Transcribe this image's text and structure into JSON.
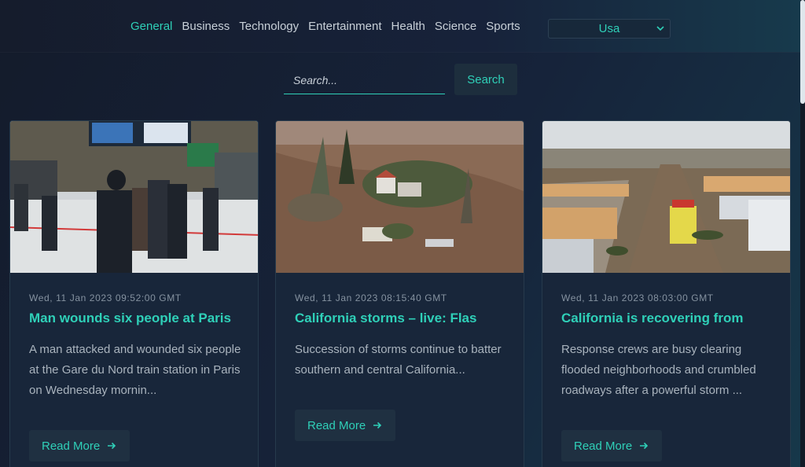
{
  "nav": {
    "items": [
      "General",
      "Business",
      "Technology",
      "Entertainment",
      "Health",
      "Science",
      "Sports"
    ],
    "active": "General"
  },
  "country": {
    "selected": "Usa"
  },
  "search": {
    "placeholder": "Search...",
    "button": "Search"
  },
  "articles": [
    {
      "date": "Wed, 11 Jan 2023 09:52:00 GMT",
      "title": "Man wounds six people at Paris",
      "description": "A man attacked and wounded six people at the Gare du Nord train station in Paris on Wednesday mornin...",
      "cta": "Read More"
    },
    {
      "date": "Wed, 11 Jan 2023 08:15:40 GMT",
      "title": "California storms – live: Flas",
      "description": "Succession of storms continue to batter southern and central California...",
      "cta": "Read More"
    },
    {
      "date": "Wed, 11 Jan 2023 08:03:00 GMT",
      "title": "California is recovering from",
      "description": "Response crews are busy clearing flooded neighborhoods and crumbled roadways after a powerful storm ...",
      "cta": "Read More"
    }
  ],
  "colors": {
    "accent": "#2fd0b8",
    "card": "#18263a",
    "background": "#141b2b"
  },
  "icons": {
    "chevron": "chevron-down-icon",
    "arrow": "arrow-right-icon"
  }
}
